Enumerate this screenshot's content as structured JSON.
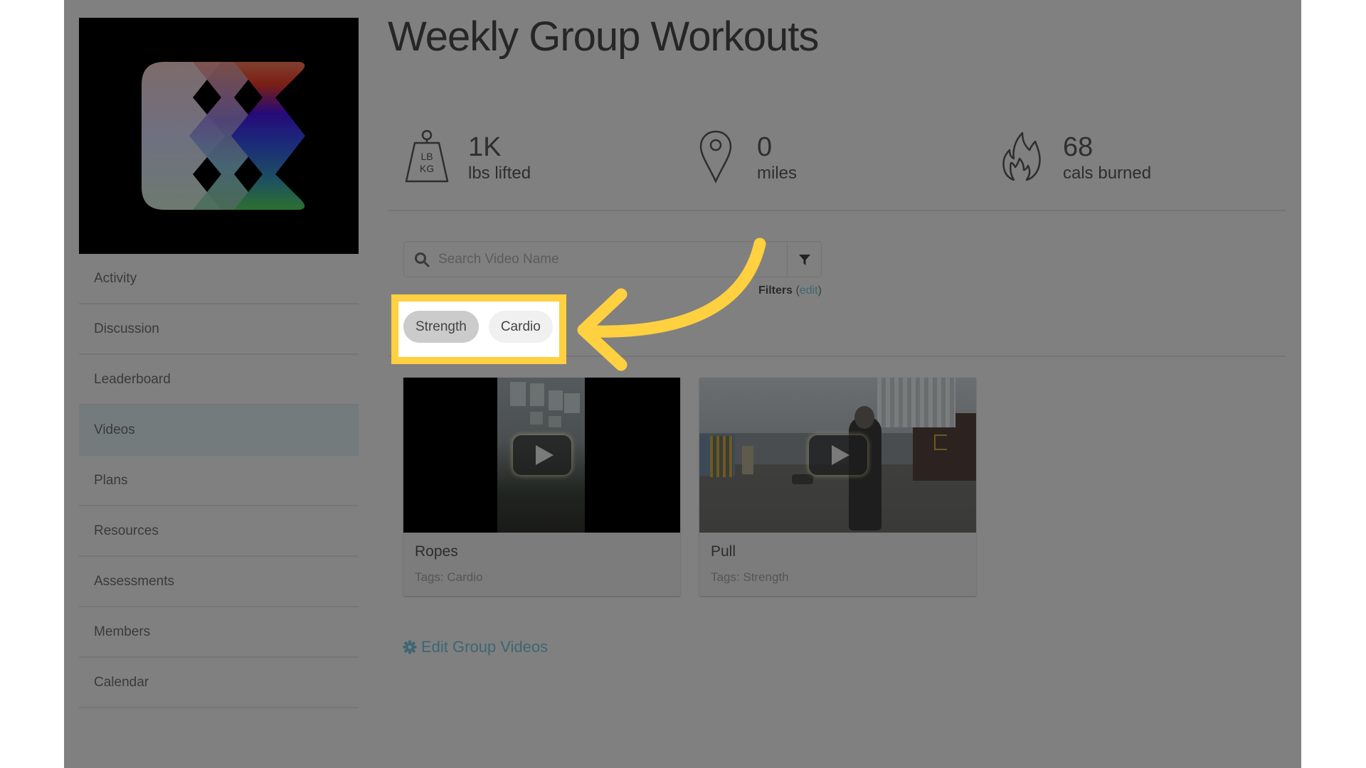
{
  "page": {
    "title": "Weekly Group Workouts"
  },
  "sidebar": {
    "logo": "app-logo",
    "items": [
      {
        "label": "Activity",
        "active": false
      },
      {
        "label": "Discussion",
        "active": false
      },
      {
        "label": "Leaderboard",
        "active": false
      },
      {
        "label": "Videos",
        "active": true
      },
      {
        "label": "Plans",
        "active": false
      },
      {
        "label": "Resources",
        "active": false
      },
      {
        "label": "Assessments",
        "active": false
      },
      {
        "label": "Members",
        "active": false
      },
      {
        "label": "Calendar",
        "active": false
      }
    ]
  },
  "stats": [
    {
      "icon": "weight-icon",
      "icon_text_top": "LB",
      "icon_text_bottom": "KG",
      "value": "1K",
      "label": "lbs lifted"
    },
    {
      "icon": "map-pin-icon",
      "value": "0",
      "label": "miles"
    },
    {
      "icon": "flame-icon",
      "value": "68",
      "label": "cals burned"
    }
  ],
  "search": {
    "placeholder": "Search Video Name",
    "value": "",
    "icon": "search-icon",
    "filter_icon": "filter-icon"
  },
  "filters": {
    "label": "Filters",
    "edit_label": "edit",
    "open_paren": "(",
    "close_paren": ")"
  },
  "tags": [
    {
      "label": "Strength",
      "active": true
    },
    {
      "label": "Cardio",
      "active": false
    }
  ],
  "videos": [
    {
      "name": "Ropes",
      "tags": "Tags: Cardio"
    },
    {
      "name": "Pull",
      "tags": "Tags: Strength"
    }
  ],
  "edit_videos": {
    "label": "Edit Group Videos",
    "icon": "gear-icon"
  },
  "annotation": {
    "highlight_color": "#ffd03f",
    "overlay_color": "#808080"
  }
}
